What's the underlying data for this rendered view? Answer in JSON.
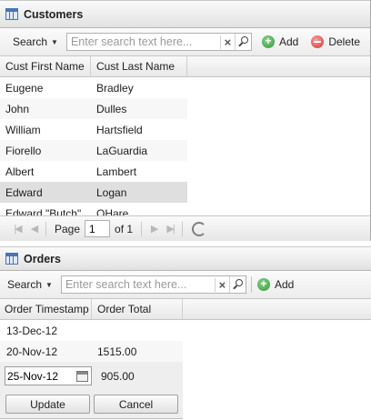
{
  "customers": {
    "title": "Customers",
    "toolbar": {
      "search_label": "Search",
      "search_placeholder": "Enter search text here...",
      "add_label": "Add",
      "delete_label": "Delete"
    },
    "columns": [
      "Cust First Name",
      "Cust Last Name"
    ],
    "rows": [
      {
        "first": "Eugene",
        "last": "Bradley"
      },
      {
        "first": "John",
        "last": "Dulles"
      },
      {
        "first": "William",
        "last": "Hartsfield"
      },
      {
        "first": "Fiorello",
        "last": "LaGuardia"
      },
      {
        "first": "Albert",
        "last": "Lambert"
      },
      {
        "first": "Edward",
        "last": "Logan"
      },
      {
        "first": "Edward \"Butch\"",
        "last": "OHare"
      }
    ],
    "selected_row": 5,
    "pager": {
      "page_label": "Page",
      "page_value": "1",
      "of_label": "of 1"
    }
  },
  "orders": {
    "title": "Orders",
    "toolbar": {
      "search_label": "Search",
      "search_placeholder": "Enter search text here...",
      "add_label": "Add"
    },
    "columns": [
      "Order Timestamp",
      "Order Total"
    ],
    "rows": [
      {
        "timestamp": "13-Dec-12",
        "total": ""
      },
      {
        "timestamp": "20-Nov-12",
        "total": "1515.00"
      }
    ],
    "editor": {
      "date_value": "25-Nov-12",
      "total": "905.00",
      "update_label": "Update",
      "cancel_label": "Cancel"
    }
  }
}
